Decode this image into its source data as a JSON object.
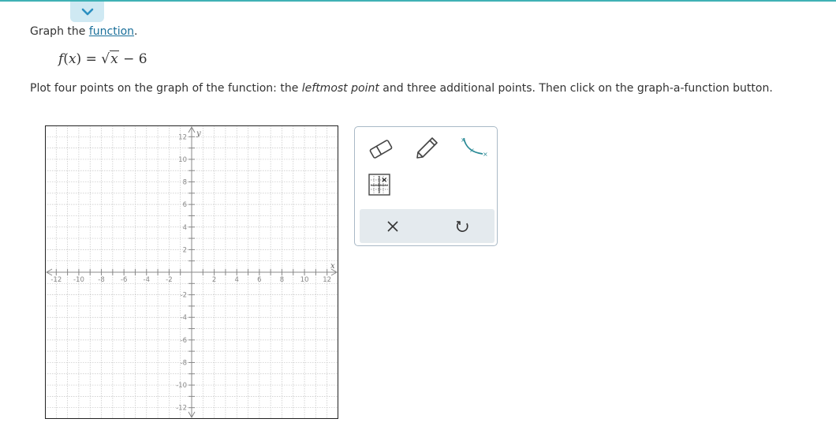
{
  "instruction": {
    "prefix": "Graph the ",
    "link": "function",
    "suffix": "."
  },
  "formula": {
    "lhs": "f",
    "arg": "x",
    "eq": " = ",
    "rad": "x",
    "tail": " − 6"
  },
  "plot_instruction": {
    "before": "Plot four points on the graph of the function: the ",
    "emph": "leftmost point",
    "after": " and three additional points. Then click on the graph-a-function button."
  },
  "graph": {
    "x_label": "x",
    "y_label": "y",
    "range": [
      -13,
      13
    ],
    "tick_values": [
      -12,
      -10,
      -8,
      -6,
      -4,
      -2,
      2,
      4,
      6,
      8,
      10,
      12
    ],
    "tick_labels": [
      "-12",
      "-10",
      "-8",
      "-6",
      "-4",
      "-2",
      "2",
      "4",
      "6",
      "8",
      "10",
      "12"
    ]
  },
  "colors": {
    "accent": "#3fb1b5",
    "tool_teal": "#2a8a96",
    "link": "#1a6f9a"
  },
  "tools": [
    {
      "name": "eraser-icon"
    },
    {
      "name": "pencil-icon"
    },
    {
      "name": "graph-a-function-icon"
    },
    {
      "name": "point-grid-icon"
    }
  ],
  "actions": [
    {
      "name": "clear-icon"
    },
    {
      "name": "undo-icon"
    }
  ]
}
